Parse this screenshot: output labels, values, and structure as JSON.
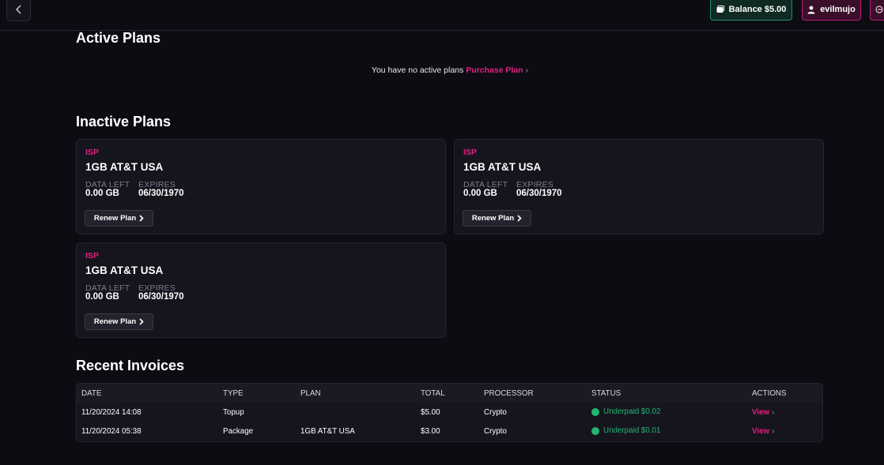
{
  "header": {
    "balance_label": "Balance $5.00",
    "username": "evilmujo"
  },
  "active_plans": {
    "title": "Active Plans",
    "empty_text": "You have no active plans",
    "purchase_link": "Purchase Plan"
  },
  "inactive_plans": {
    "title": "Inactive Plans",
    "cards": [
      {
        "tag": "ISP",
        "name": "1GB AT&T USA",
        "data_left_label": "DATA LEFT",
        "data_left": "0.00 GB",
        "expires_label": "EXPIRES",
        "expires": "06/30/1970",
        "renew_label": "Renew Plan"
      },
      {
        "tag": "ISP",
        "name": "1GB AT&T USA",
        "data_left_label": "DATA LEFT",
        "data_left": "0.00 GB",
        "expires_label": "EXPIRES",
        "expires": "06/30/1970",
        "renew_label": "Renew Plan"
      },
      {
        "tag": "ISP",
        "name": "1GB AT&T USA",
        "data_left_label": "DATA LEFT",
        "data_left": "0.00 GB",
        "expires_label": "EXPIRES",
        "expires": "06/30/1970",
        "renew_label": "Renew Plan"
      }
    ]
  },
  "invoices": {
    "title": "Recent Invoices",
    "columns": [
      "DATE",
      "TYPE",
      "PLAN",
      "TOTAL",
      "PROCESSOR",
      "STATUS",
      "ACTIONS"
    ],
    "rows": [
      {
        "date": "11/20/2024 14:08",
        "type": "Topup",
        "plan": "",
        "total": "$5.00",
        "processor": "Crypto",
        "status": "Underpaid $0.02",
        "action": "View"
      },
      {
        "date": "11/20/2024 05:38",
        "type": "Package",
        "plan": "1GB AT&T USA",
        "total": "$3.00",
        "processor": "Crypto",
        "status": "Underpaid $0.01",
        "action": "View"
      }
    ]
  },
  "colors": {
    "accent": "#e0207f",
    "success": "#22b573",
    "background": "#0d0c13",
    "card": "#16151e"
  },
  "icons": {
    "back": "chevron-left-icon",
    "balance": "wallet-icon",
    "user": "user-icon",
    "logout": "logout-icon"
  }
}
